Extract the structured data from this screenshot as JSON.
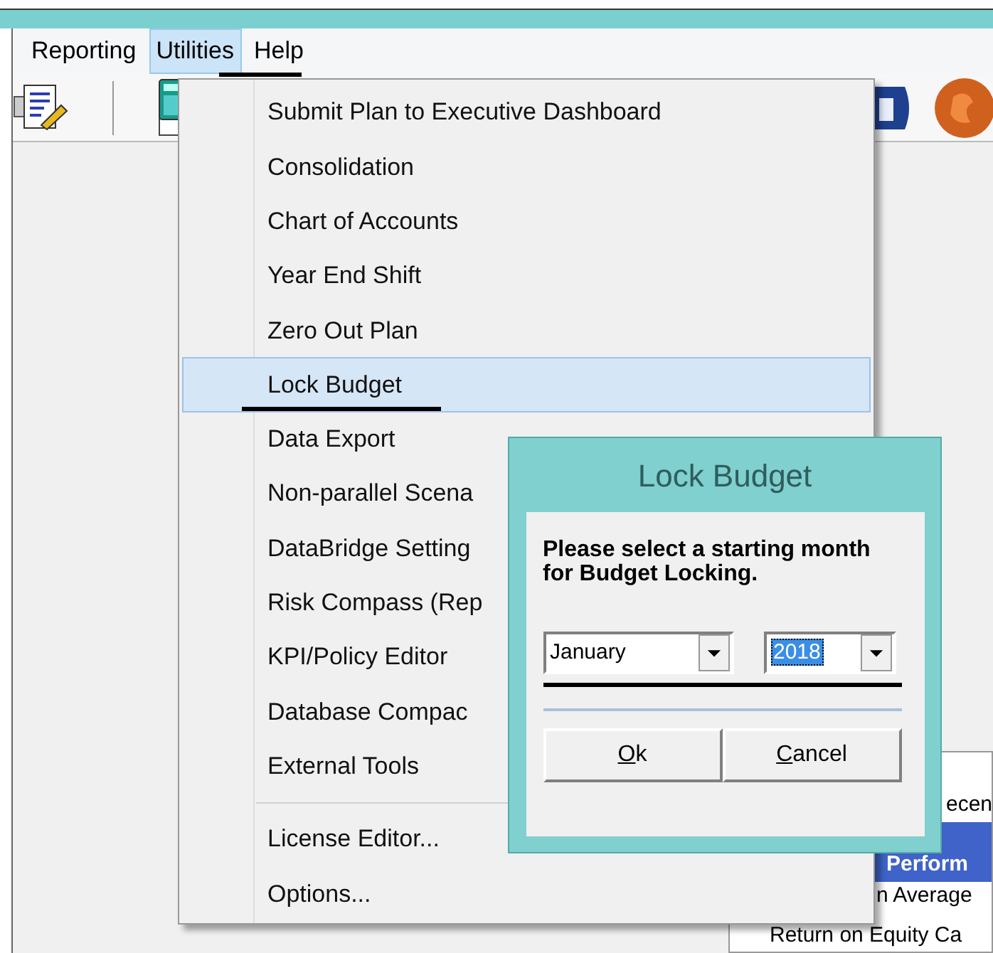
{
  "menubar": [
    {
      "label": "Reporting",
      "selected": false
    },
    {
      "label": "Utilities",
      "selected": true
    },
    {
      "label": "Help",
      "selected": false
    }
  ],
  "menu": {
    "items": [
      {
        "kind": "item",
        "label": "Submit Plan to Executive Dashboard",
        "selected": false
      },
      {
        "kind": "item",
        "label": "Consolidation",
        "selected": false
      },
      {
        "kind": "item",
        "label": "Chart of Accounts",
        "selected": false
      },
      {
        "kind": "item",
        "label": "Year End Shift",
        "selected": false
      },
      {
        "kind": "item",
        "label": "Zero Out Plan",
        "selected": false
      },
      {
        "kind": "item",
        "label": "Lock Budget",
        "selected": true
      },
      {
        "kind": "item",
        "label": "Data Export",
        "selected": false
      },
      {
        "kind": "item",
        "label": "Non-parallel Scena",
        "selected": false
      },
      {
        "kind": "item",
        "label": "DataBridge Setting",
        "selected": false
      },
      {
        "kind": "item",
        "label": "Risk Compass (Rep",
        "selected": false
      },
      {
        "kind": "item",
        "label": "KPI/Policy Editor",
        "selected": false
      },
      {
        "kind": "item",
        "label": "Database Compac",
        "selected": false
      },
      {
        "kind": "item",
        "label": "External Tools",
        "selected": false
      },
      {
        "kind": "separator"
      },
      {
        "kind": "item",
        "label": "License Editor...",
        "selected": false
      },
      {
        "kind": "item",
        "label": "Options...",
        "selected": false
      }
    ]
  },
  "dialog": {
    "title": "Lock Budget",
    "message": "Please select a starting month for Budget Locking.",
    "month": {
      "value": "January",
      "selected": false
    },
    "year": {
      "value": "2018",
      "selected": true
    },
    "buttons": [
      {
        "label": "Ok",
        "underline_first": true
      },
      {
        "label": "Cancel",
        "underline_first": true
      }
    ]
  },
  "list": {
    "rows": [
      {
        "text": "ecen",
        "selected": false
      },
      {
        "text": "Perform",
        "selected": true
      },
      {
        "text": "n Average",
        "selected": false
      },
      {
        "text": "Return on Equity Ca",
        "selected": false
      }
    ]
  }
}
